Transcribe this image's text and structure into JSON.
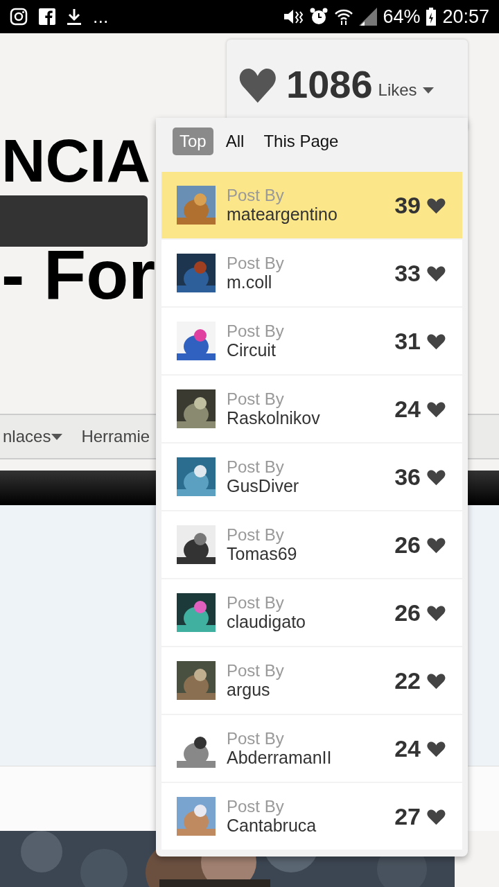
{
  "status_bar": {
    "overflow": "...",
    "battery": "64%",
    "time": "20:57"
  },
  "page": {
    "title": "NCIA",
    "subtitle": "- For",
    "nav": [
      {
        "label": "nlaces",
        "dropdown": true
      },
      {
        "label": "Herramie",
        "dropdown": false
      }
    ]
  },
  "likes": {
    "count": "1086",
    "label": "Likes",
    "tabs": [
      {
        "label": "Top",
        "selected": true
      },
      {
        "label": "All",
        "selected": false
      },
      {
        "label": "This Page",
        "selected": false
      }
    ],
    "rows": [
      {
        "caption": "Post By",
        "user": "mateargentino",
        "count": "39",
        "selected": true
      },
      {
        "caption": "Post By",
        "user": "m.coll",
        "count": "33",
        "selected": false
      },
      {
        "caption": "Post By",
        "user": "Circuit",
        "count": "31",
        "selected": false
      },
      {
        "caption": "Post By",
        "user": "Raskolnikov",
        "count": "24",
        "selected": false
      },
      {
        "caption": "Post By",
        "user": "GusDiver",
        "count": "36",
        "selected": false
      },
      {
        "caption": "Post By",
        "user": "Tomas69",
        "count": "26",
        "selected": false
      },
      {
        "caption": "Post By",
        "user": "claudigato",
        "count": "26",
        "selected": false
      },
      {
        "caption": "Post By",
        "user": "argus",
        "count": "22",
        "selected": false
      },
      {
        "caption": "Post By",
        "user": "AbderramanII",
        "count": "24",
        "selected": false
      },
      {
        "caption": "Post By",
        "user": "Cantabruca",
        "count": "27",
        "selected": false
      }
    ]
  }
}
